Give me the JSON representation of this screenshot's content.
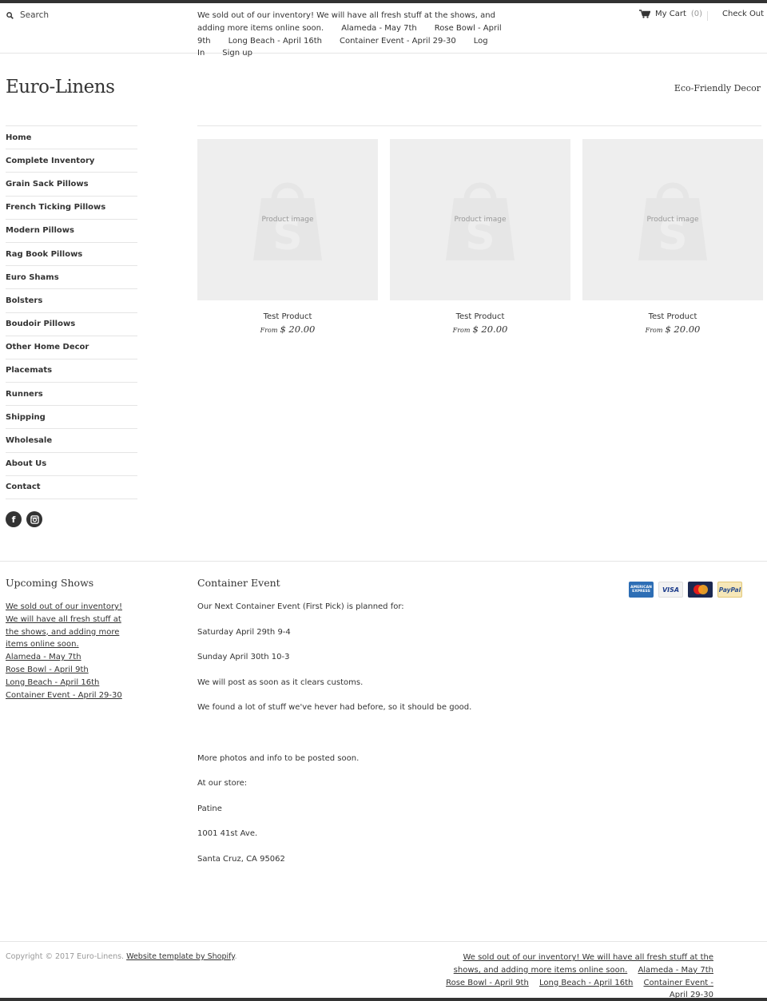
{
  "header": {
    "search_label": "Search",
    "announcement": "We sold out of our inventory! We will have all fresh stuff at the shows, and adding more items online soon.",
    "links": [
      "Alameda - May 7th",
      "Rose Bowl - April 9th",
      "Long Beach - April 16th",
      "Container Event - April 29-30",
      "Log In",
      "Sign up"
    ],
    "cart_label": "My Cart",
    "cart_count": "(0)",
    "checkout_label": "Check Out"
  },
  "brand": {
    "logo": "Euro-Linens",
    "tagline": "Eco-Friendly Decor"
  },
  "nav": {
    "items": [
      "Home",
      "Complete Inventory",
      "Grain Sack Pillows",
      "French Ticking Pillows",
      "Modern Pillows",
      "Rag Book Pillows",
      "Euro Shams",
      "Bolsters",
      "Boudoir Pillows",
      "Other Home Decor",
      "Placemats",
      "Runners",
      "Shipping",
      "Wholesale",
      "About Us",
      "Contact"
    ]
  },
  "social": {
    "facebook": "f"
  },
  "products": [
    {
      "placeholder": "Product image",
      "title": "Test Product",
      "from": "From",
      "price": "$ 20.00"
    },
    {
      "placeholder": "Product image",
      "title": "Test Product",
      "from": "From",
      "price": "$ 20.00"
    },
    {
      "placeholder": "Product image",
      "title": "Test Product",
      "from": "From",
      "price": "$ 20.00"
    }
  ],
  "footer": {
    "shows_title": "Upcoming Shows",
    "shows_links": [
      "We sold out of our inventory! We will have all fresh stuff at the shows, and adding more items online soon.",
      "Alameda - May 7th",
      "Rose Bowl - April 9th",
      "Long Beach - April 16th",
      "Container Event - April 29-30"
    ],
    "container_title": "Container Event",
    "container_lines": [
      "Our Next Container Event (First Pick) is planned for:",
      "Saturday April 29th 9-4",
      "Sunday April 30th 10-3",
      "We will post as soon as it clears customs.",
      "We found a lot of stuff we've hever had before, so it should be good.",
      "",
      "More photos and info to be posted soon.",
      "At our store:",
      "Patine",
      "1001 41st Ave.",
      "Santa Cruz, CA 95062"
    ],
    "payments": {
      "amex": "AMERICAN EXPRESS",
      "visa": "VISA",
      "paypal": "PayPal"
    },
    "copyright": "Copyright © 2017 Euro-Linens.",
    "template_link": "Website template by Shopify",
    "period": ".",
    "bottom_links": [
      "We sold out of our inventory! We will have all fresh stuff at the shows, and adding more items online soon.",
      "Alameda - May 7th",
      "Rose Bowl - April 9th",
      "Long Beach - April 16th",
      "Container Event - April 29-30"
    ]
  }
}
